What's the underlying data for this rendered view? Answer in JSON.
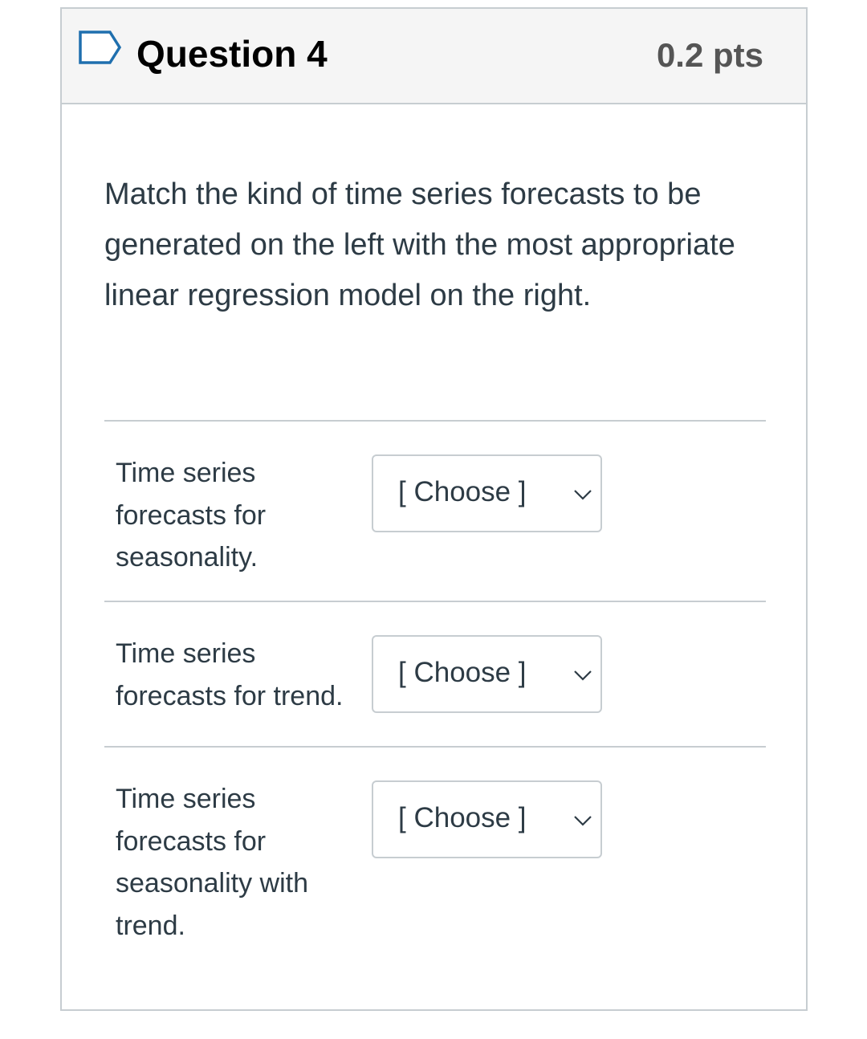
{
  "question": {
    "title": "Question 4",
    "points": "0.2 pts",
    "flag_icon": "flag-outline-icon",
    "text": "Match the kind of time series forecasts to be generated on the left with the most appropriate linear regression model on the right."
  },
  "matches": [
    {
      "label": "Time series forecasts for seasonality.",
      "selected": "[ Choose ]",
      "icon": "chevron-down-icon"
    },
    {
      "label": "Time series forecasts for trend.",
      "selected": "[ Choose ]",
      "icon": "chevron-down-icon"
    },
    {
      "label": "Time series forecasts for seasonality with trend.",
      "selected": "[ Choose ]",
      "icon": "chevron-down-icon"
    }
  ],
  "colors": {
    "header_background": "#f5f5f5",
    "border": "#c7cdd1",
    "title_text": "#000000",
    "points_text": "#555555",
    "body_text": "#2d3b45"
  }
}
